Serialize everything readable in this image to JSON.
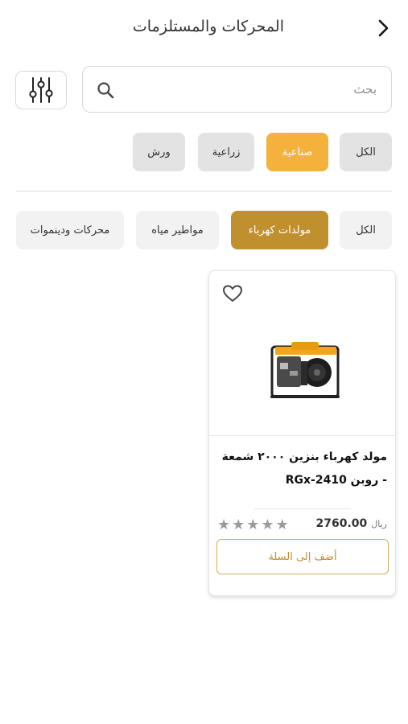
{
  "header": {
    "title": "المحركات والمستلزمات",
    "back_icon": "chevron-right-icon"
  },
  "search": {
    "placeholder": "بحث",
    "value": "",
    "icon": "search-icon"
  },
  "filter": {
    "icon": "sliders-icon"
  },
  "category_tabs": [
    {
      "label": "الكل",
      "selected": false
    },
    {
      "label": "صناعية",
      "selected": true
    },
    {
      "label": "زراعية",
      "selected": false
    },
    {
      "label": "ورش",
      "selected": false
    }
  ],
  "subcategory_tabs": [
    {
      "label": "الكل",
      "selected": false
    },
    {
      "label": "مولدات كهرباء",
      "selected": true
    },
    {
      "label": "مواطير مياه",
      "selected": false
    },
    {
      "label": "محركات ودينموات",
      "selected": false
    }
  ],
  "product": {
    "name": "مولد كهرباء بنزين ٢٠٠٠ شمعة - روبن RGx-2410",
    "price": "2760.00",
    "currency": "ريال",
    "rating": 0,
    "max_rating": 5,
    "add_to_cart_label": "أضف إلى السلة",
    "favorite_icon": "heart-outline-icon",
    "image_icon": "generator-image"
  },
  "colors": {
    "accent_yellow": "#f4b23c",
    "accent_brown": "#c0902f",
    "chip_gray": "#e3e3e3",
    "chip_light": "#f2f2f2",
    "star_gray": "#9a9a9a"
  }
}
